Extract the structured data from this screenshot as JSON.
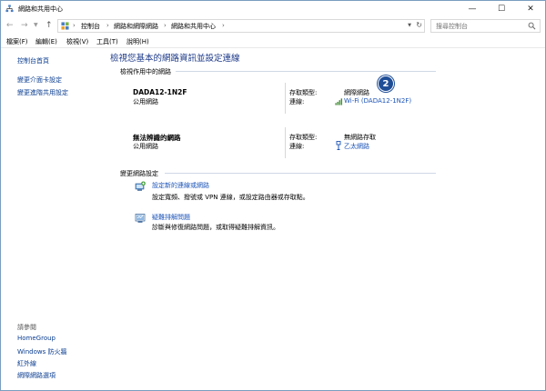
{
  "window": {
    "title": "網路和共用中心",
    "controls": {
      "minimize": "—",
      "maximize": "☐",
      "close": "✕"
    }
  },
  "address": {
    "breadcrumbs": [
      "控制台",
      "網路和網際網路",
      "網路和共用中心"
    ],
    "separator": "›",
    "search_placeholder": "搜尋控制台"
  },
  "menu": [
    "檔案(F)",
    "編輯(E)",
    "檢視(V)",
    "工具(T)",
    "說明(H)"
  ],
  "sidebar": {
    "top_links": [
      "控制台首頁",
      "變更介面卡設定",
      "變更進階共用設定"
    ],
    "see_also_label": "請參閱",
    "see_also_links": [
      "HomeGroup",
      "Windows 防火牆",
      "紅外線",
      "網際網路選項"
    ]
  },
  "main": {
    "title": "檢視您基本的網路資訊並設定連線",
    "active_section": "檢視作用中的網路",
    "networks": [
      {
        "name": "DADA12-1N2F",
        "type": "公用網路",
        "access_label": "存取類型:",
        "access_value": "網際網路",
        "conn_label": "連線:",
        "conn_value": "Wi-Fi (DADA12-1N2F)"
      },
      {
        "name": "無法辨識的網路",
        "type": "公用網路",
        "access_label": "存取類型:",
        "access_value": "無網路存取",
        "conn_label": "連線:",
        "conn_value": "乙太網路"
      }
    ],
    "badge": "2",
    "change_section": "變更網路設定",
    "tasks": [
      {
        "link": "設定新的連線或網路",
        "desc": "設定寬頻、撥號或 VPN 連線，或設定路由器或存取點。"
      },
      {
        "link": "疑難排解問題",
        "desc": "診斷與修復網路問題，或取得疑難排解資訊。"
      }
    ]
  },
  "colors": {
    "link": "#1c54b8",
    "title": "#1e3b8a",
    "badge": "#1f4e97",
    "wifi": "#3c8a2e"
  }
}
